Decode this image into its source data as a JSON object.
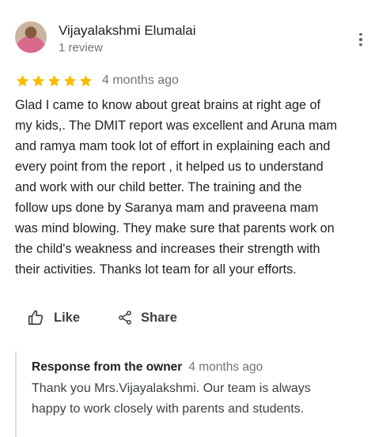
{
  "reviewer": {
    "name": "Vijayalakshmi Elumalai",
    "review_count": "1 review"
  },
  "rating": {
    "stars": 5,
    "max_stars": 5,
    "time_ago": "4 months ago"
  },
  "review": {
    "text_lines": [
      "Glad I came to know about great brains at right age of",
      "my kids,. The  DMIT report was excellent and Aruna mam",
      "and ramya mam took lot of effort in explaining each and",
      "every point from the report , it helped us to understand",
      "and work with our child better. The training  and the",
      "follow ups done by Saranya mam and praveena mam",
      "was mind blowing. They make sure that parents work on",
      "the child's weakness and increases their strength with",
      "their activities. Thanks lot team for all your efforts."
    ]
  },
  "actions": {
    "like_label": "Like",
    "share_label": "Share"
  },
  "owner_response": {
    "label": "Response from the owner",
    "time_ago": "4 months ago",
    "text_lines": [
      "Thank you Mrs.Vijayalakshmi. Our team is always",
      "happy to work closely with parents and students."
    ]
  },
  "colors": {
    "star": "#fbbc04",
    "secondary_text": "#70757a",
    "divider": "#dadce0"
  },
  "icons": {
    "more": "more-vert-icon",
    "star": "star-icon",
    "like": "thumb-up-icon",
    "share": "share-icon"
  }
}
